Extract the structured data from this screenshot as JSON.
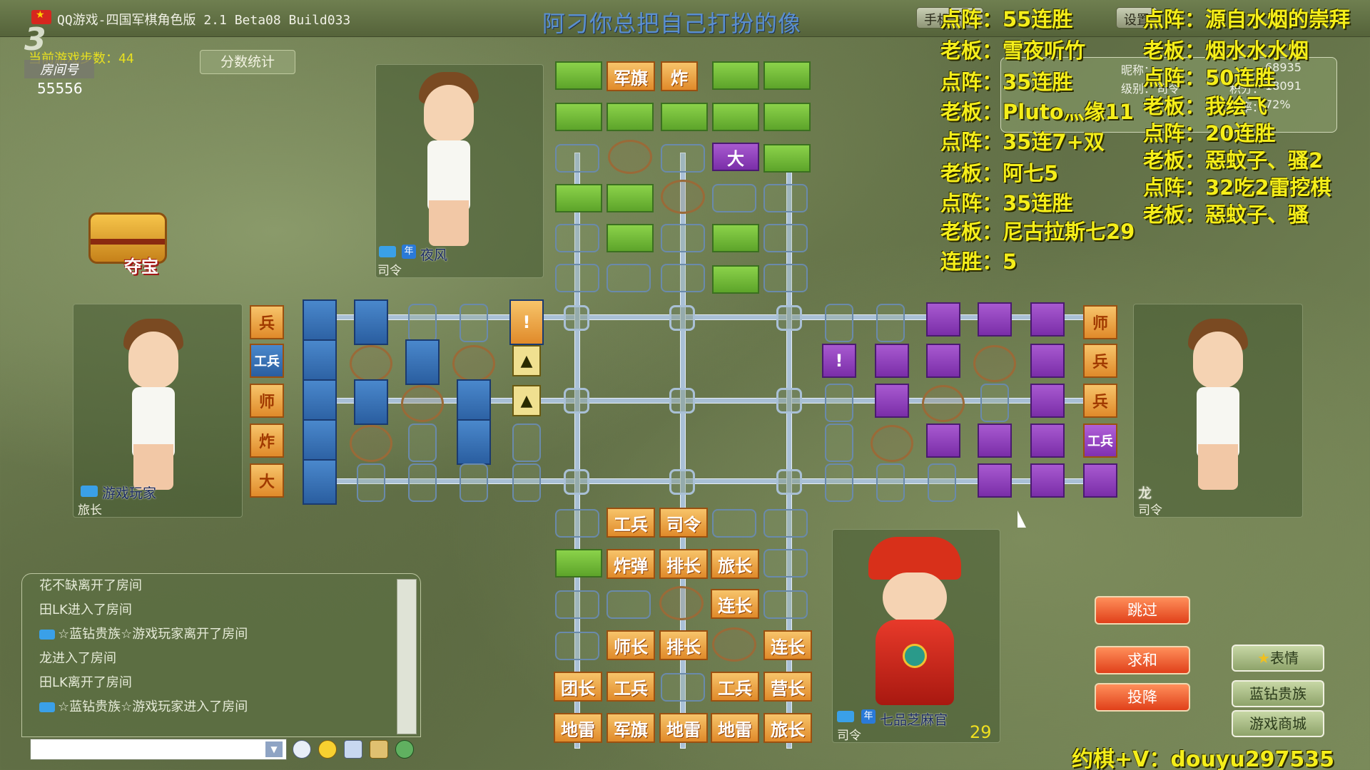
{
  "title_bar": {
    "app_title": "QQ游戏-四国军棋角色版 2.1 Beta08 Build033",
    "banner": "阿刁你总把自己打扮的像",
    "btn_download": "手机下载",
    "btn_settings": "设置"
  },
  "room": {
    "logo": "3",
    "room_label": "房间号",
    "room_no": "55556",
    "steps": "当前游戏步数：44",
    "score_button": "分数统计",
    "treasure_label": "夺宝"
  },
  "players": {
    "top": {
      "name": "夜风",
      "rank": "司令",
      "year_badge": "年"
    },
    "left": {
      "name": "游戏玩家",
      "rank": "旅长"
    },
    "right": {
      "name": "龙",
      "rank": "司令"
    },
    "bottom": {
      "name": "七品芝麻官",
      "rank": "司令",
      "year_badge": "年",
      "timer": "29"
    }
  },
  "chat": {
    "messages": [
      {
        "vip": false,
        "text": "花不缺离开了房间"
      },
      {
        "vip": false,
        "text": "田LK进入了房间"
      },
      {
        "vip": true,
        "text": "☆蓝钻贵族☆游戏玩家离开了房间"
      },
      {
        "vip": false,
        "text": "龙进入了房间"
      },
      {
        "vip": false,
        "text": "田LK离开了房间"
      },
      {
        "vip": true,
        "text": "☆蓝钻贵族☆游戏玩家进入了房间"
      }
    ],
    "input_value": ""
  },
  "board": {
    "top_visible": [
      "军旗",
      "炸"
    ],
    "top_enemy_marked": [
      "大"
    ],
    "left_markers": [
      "兵",
      "工兵",
      "师",
      "炸",
      "大"
    ],
    "right_markers": [
      "师",
      "兵",
      "兵",
      "工兵"
    ],
    "left_alerts": [
      "!",
      "▲",
      "▲"
    ],
    "right_alerts": [
      "!"
    ],
    "bottom_rows": [
      [
        "",
        "工兵",
        "司令",
        "",
        ""
      ],
      [
        "",
        "炸弹",
        "排长",
        "旅长",
        ""
      ],
      [
        "",
        "",
        "",
        "连长",
        ""
      ],
      [
        "",
        "师长",
        "排长",
        "",
        "连长"
      ],
      [
        "团长",
        "工兵",
        "",
        "工兵",
        "营长"
      ],
      [
        "地雷",
        "军旗",
        "地雷",
        "地雷",
        "旅长"
      ]
    ]
  },
  "stats": {
    "nickname_label": "昵称：",
    "level_label": "级别：",
    "level_value": "司令",
    "score_a": "68935",
    "score_b_label": "积分：",
    "score_b": "18091",
    "rate_label": "胜率：",
    "rate": "72%"
  },
  "overlay_left": [
    "点阵：55连胜",
    "老板：雪夜听竹",
    "点阵：35连胜",
    "老板：Pluto灬缘11",
    "点阵：35连7+双",
    "老板：阿七5",
    "点阵：35连胜",
    "老板：尼古拉斯七29",
    "连胜：5"
  ],
  "overlay_right": [
    "点阵：源自水烟的崇拜",
    "老板：烟水水水烟",
    "点阵：50连胜",
    "老板：我绘飞",
    "点阵：20连胜",
    "老板：惡蚊子、骚2",
    "点阵：32吃2雷挖棋",
    "老板：惡蚊子、骚"
  ],
  "actions": {
    "skip": "跳过",
    "draw": "求和",
    "surrender": "投降",
    "emote": "表情",
    "blue_diamond": "蓝钻贵族",
    "shop": "游戏商城"
  },
  "contact": "约棋+V：douyu297535",
  "colors": {
    "own_piece": "#f0a040",
    "top_player": "#6cc03a",
    "left_player": "#3a78c0",
    "right_player": "#9a44c8"
  }
}
